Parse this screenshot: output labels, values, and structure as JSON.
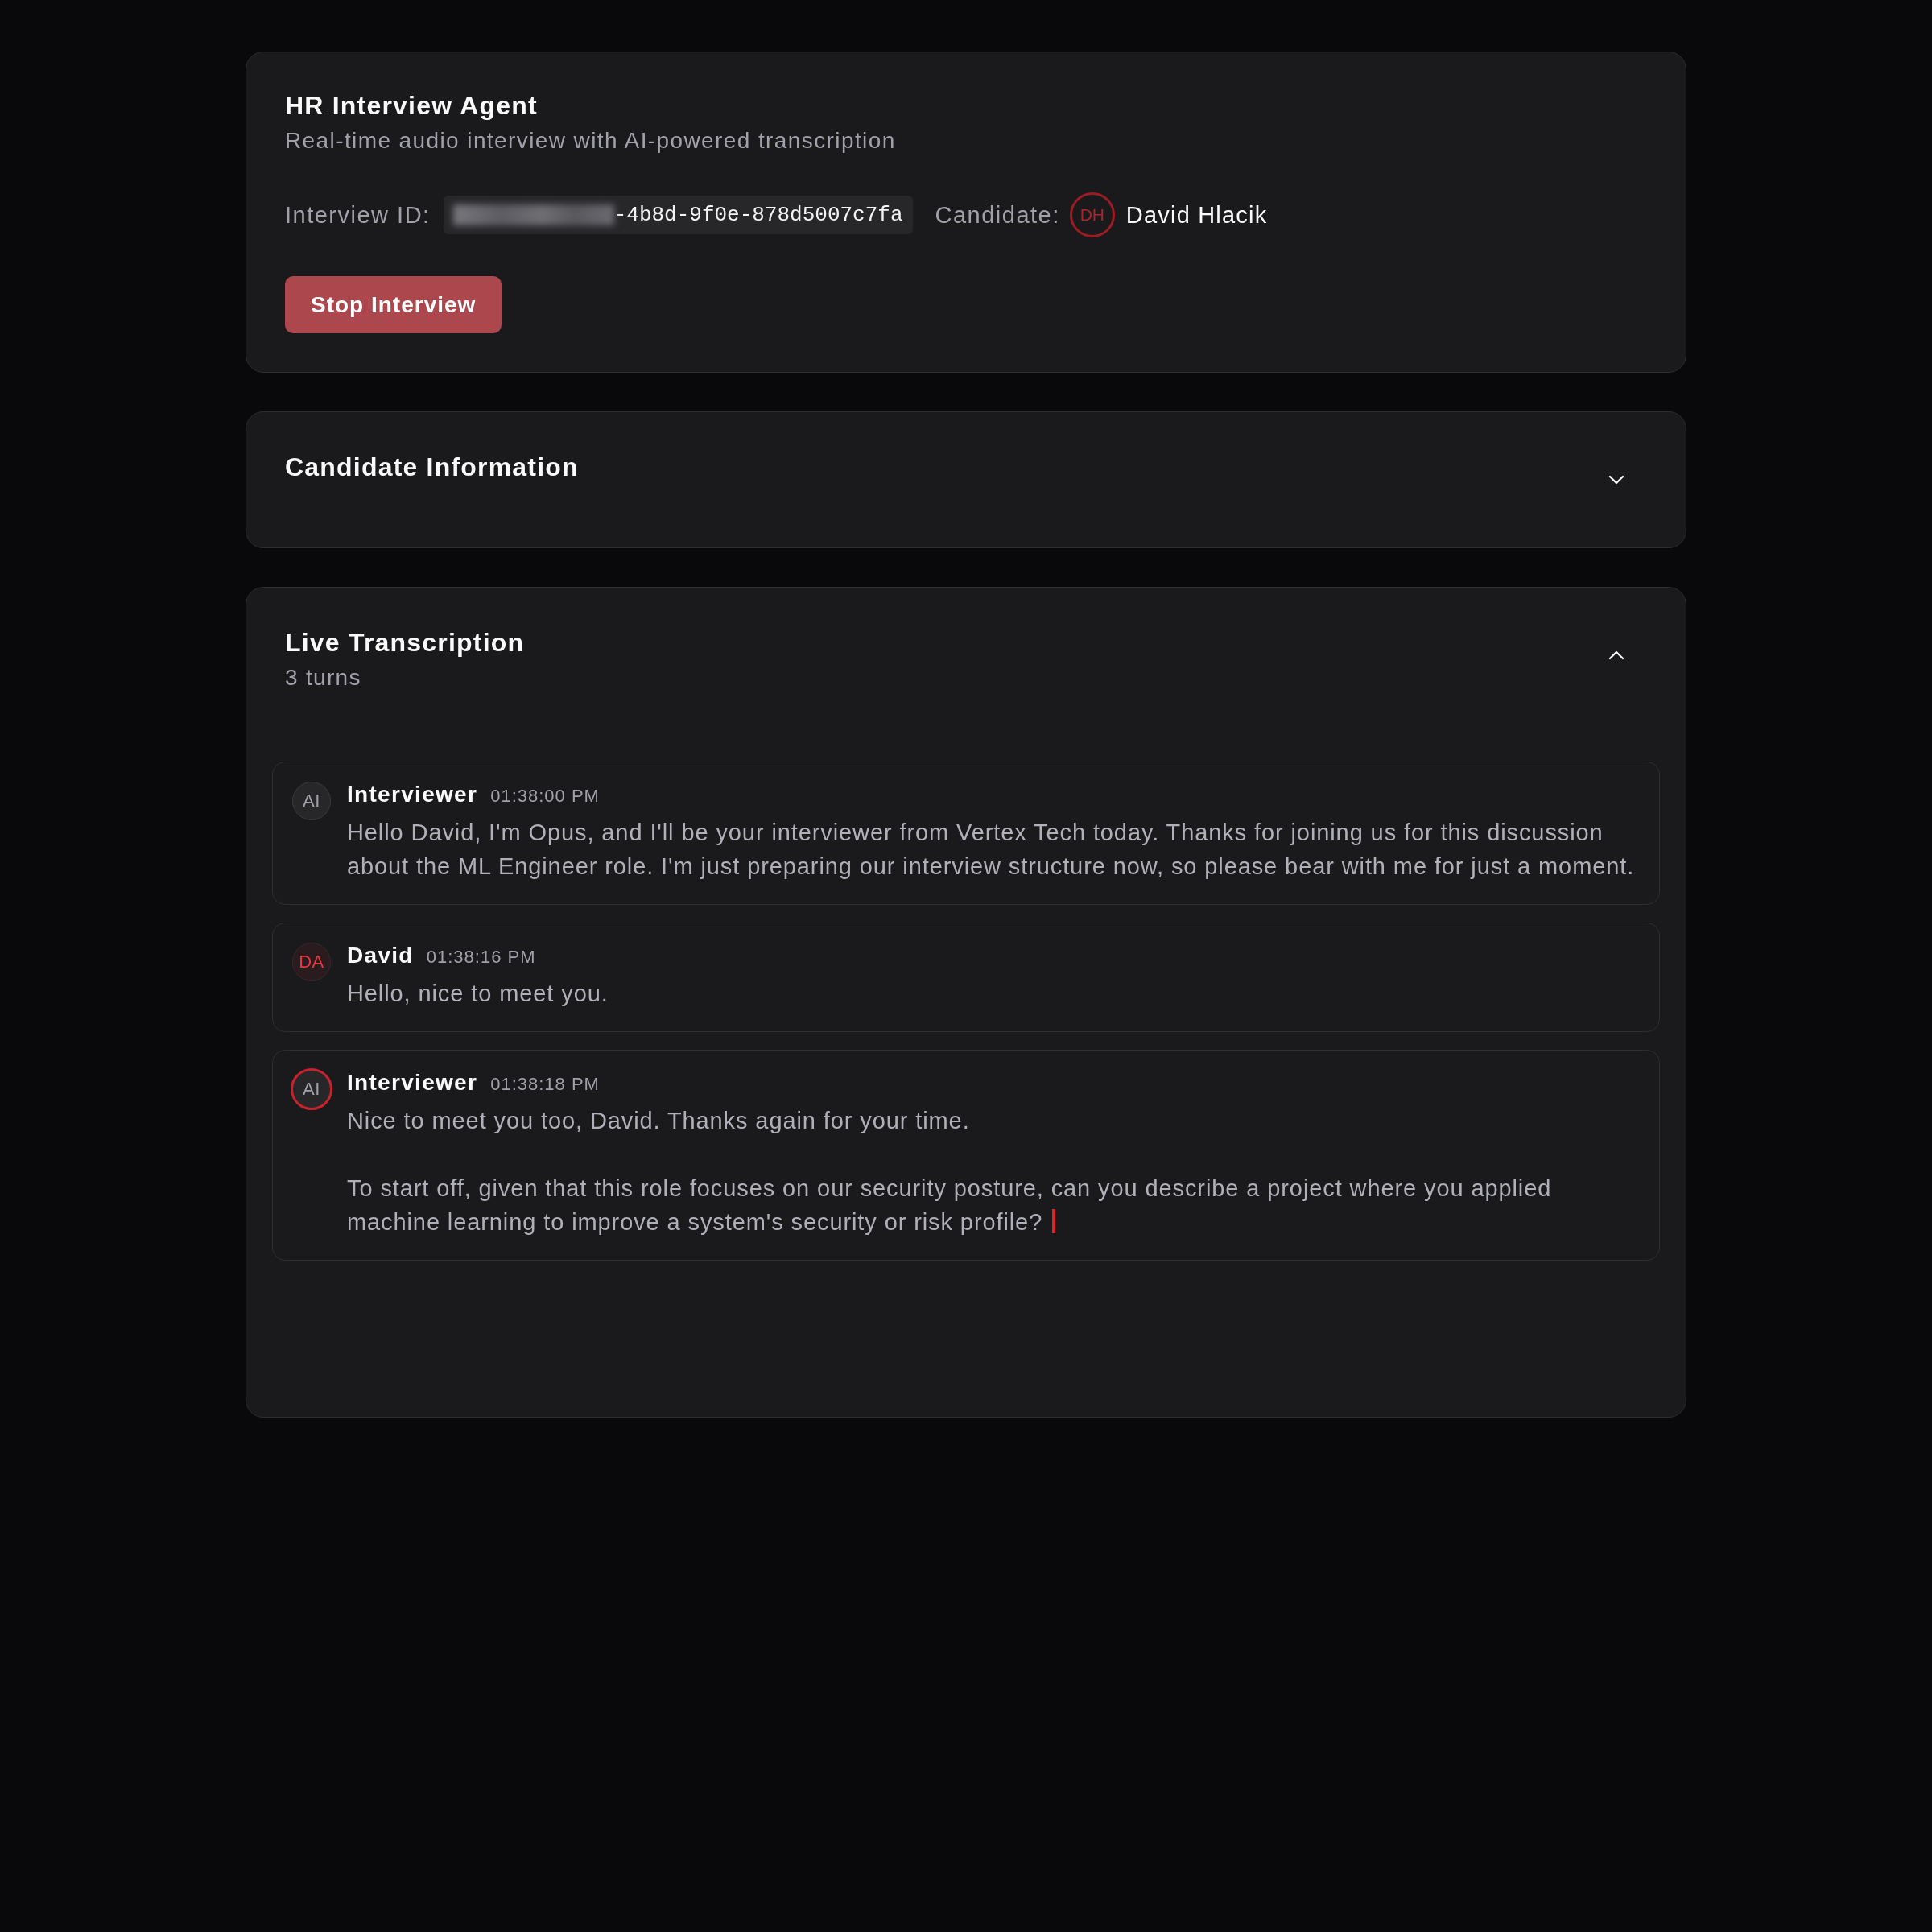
{
  "header": {
    "title": "HR Interview Agent",
    "subtitle": "Real-time audio interview with AI-powered transcription",
    "interview_id_label": "Interview ID:",
    "interview_id": {
      "redacted": true,
      "value": "-4b8d-9f0e-878d5007c7fa"
    },
    "candidate_label": "Candidate:",
    "candidate": {
      "initials": "DH",
      "name": "David Hlacik"
    },
    "stop_button": "Stop Interview"
  },
  "sections": [
    {
      "title": "Candidate Information",
      "expanded": false
    },
    {
      "title": "Live Transcription",
      "subtitle": "3 turns",
      "expanded": true,
      "turns": [
        {
          "kind": "interviewer",
          "initials": "AI",
          "speaker": "Interviewer",
          "time": "01:38:00 PM",
          "speaking": false,
          "text": "Hello David, I'm Opus, and I'll be your interviewer from Vertex Tech today. Thanks for joining us for this discussion about the ML Engineer role. I'm just preparing our interview structure now, so please bear with me for just a moment."
        },
        {
          "kind": "candidate",
          "initials": "DA",
          "speaker": "David",
          "time": "01:38:16 PM",
          "speaking": false,
          "text": "Hello, nice to meet you."
        },
        {
          "kind": "interviewer",
          "initials": "AI",
          "speaker": "Interviewer",
          "time": "01:38:18 PM",
          "speaking": true,
          "text": "Nice to meet you too, David. Thanks again for your time.\n\nTo start off, given that this role focuses on our security posture, can you describe a project where you applied machine learning to improve a system's security or risk profile?"
        }
      ]
    }
  ]
}
